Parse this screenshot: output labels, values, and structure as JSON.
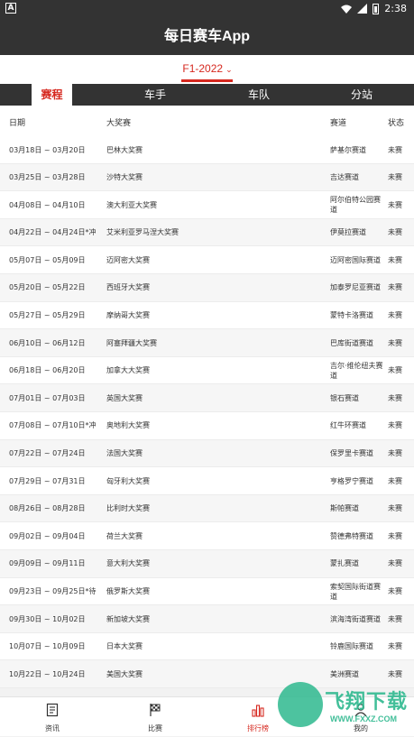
{
  "status_bar": {
    "time": "2:38",
    "notification_icon": "A"
  },
  "app": {
    "title": "每日赛车App"
  },
  "season": {
    "selected": "F1-2022"
  },
  "tabs": [
    {
      "label": "赛程",
      "active": true
    },
    {
      "label": "车手",
      "active": false
    },
    {
      "label": "车队",
      "active": false
    },
    {
      "label": "分站",
      "active": false
    }
  ],
  "table": {
    "headers": {
      "date": "日期",
      "grand_prix": "大奖赛",
      "circuit": "赛道",
      "status": "状态"
    },
    "rows": [
      {
        "date": "03月18日 ~ 03月20日",
        "gp": "巴林大奖赛",
        "venue": "萨基尔赛道",
        "status": "未赛"
      },
      {
        "date": "03月25日 ~ 03月28日",
        "gp": "沙特大奖赛",
        "venue": "吉达赛道",
        "status": "未赛"
      },
      {
        "date": "04月08日 ~ 04月10日",
        "gp": "澳大利亚大奖赛",
        "venue": "阿尔伯特公园赛道",
        "status": "未赛"
      },
      {
        "date": "04月22日 ~ 04月24日*冲",
        "gp": "艾米利亚罗马涅大奖赛",
        "venue": "伊莫拉赛道",
        "status": "未赛"
      },
      {
        "date": "05月07日 ~ 05月09日",
        "gp": "迈阿密大奖赛",
        "venue": "迈阿密国际赛道",
        "status": "未赛"
      },
      {
        "date": "05月20日 ~ 05月22日",
        "gp": "西班牙大奖赛",
        "venue": "加泰罗尼亚赛道",
        "status": "未赛"
      },
      {
        "date": "05月27日 ~ 05月29日",
        "gp": "摩纳哥大奖赛",
        "venue": "蒙特卡洛赛道",
        "status": "未赛"
      },
      {
        "date": "06月10日 ~ 06月12日",
        "gp": "阿塞拜疆大奖赛",
        "venue": "巴库街道赛道",
        "status": "未赛"
      },
      {
        "date": "06月18日 ~ 06月20日",
        "gp": "加拿大大奖赛",
        "venue": "吉尔·维伦纽夫赛道",
        "status": "未赛"
      },
      {
        "date": "07月01日 ~ 07月03日",
        "gp": "英国大奖赛",
        "venue": "银石赛道",
        "status": "未赛"
      },
      {
        "date": "07月08日 ~ 07月10日*冲",
        "gp": "奥地利大奖赛",
        "venue": "红牛环赛道",
        "status": "未赛"
      },
      {
        "date": "07月22日 ~ 07月24日",
        "gp": "法国大奖赛",
        "venue": "保罗里卡赛道",
        "status": "未赛"
      },
      {
        "date": "07月29日 ~ 07月31日",
        "gp": "匈牙利大奖赛",
        "venue": "亨格罗宁赛道",
        "status": "未赛"
      },
      {
        "date": "08月26日 ~ 08月28日",
        "gp": "比利时大奖赛",
        "venue": "斯帕赛道",
        "status": "未赛"
      },
      {
        "date": "09月02日 ~ 09月04日",
        "gp": "荷兰大奖赛",
        "venue": "赞德弗特赛道",
        "status": "未赛"
      },
      {
        "date": "09月09日 ~ 09月11日",
        "gp": "意大利大奖赛",
        "venue": "蒙扎赛道",
        "status": "未赛"
      },
      {
        "date": "09月23日 ~ 09月25日*待",
        "gp": "俄罗斯大奖赛",
        "venue": "索契国际街道赛道",
        "status": "未赛"
      },
      {
        "date": "09月30日 ~ 10月02日",
        "gp": "新加坡大奖赛",
        "venue": "滨海湾街道赛道",
        "status": "未赛"
      },
      {
        "date": "10月07日 ~ 10月09日",
        "gp": "日本大奖赛",
        "venue": "铃鹿国际赛道",
        "status": "未赛"
      },
      {
        "date": "10月22日 ~ 10月24日",
        "gp": "美国大奖赛",
        "venue": "美洲赛道",
        "status": "未赛"
      }
    ]
  },
  "bottom_nav": [
    {
      "label": "资讯",
      "icon": "document-icon",
      "active": false
    },
    {
      "label": "比赛",
      "icon": "checkered-flag-icon",
      "active": false
    },
    {
      "label": "排行榜",
      "icon": "bar-chart-icon",
      "active": true
    },
    {
      "label": "我的",
      "icon": "person-icon",
      "active": false
    }
  ],
  "watermark": {
    "text": "飞翔下载",
    "url": "WWW.FXXZ.COM"
  },
  "colors": {
    "bar": "#333333",
    "accent": "#d6281f",
    "watermark": "#2eb88e"
  }
}
